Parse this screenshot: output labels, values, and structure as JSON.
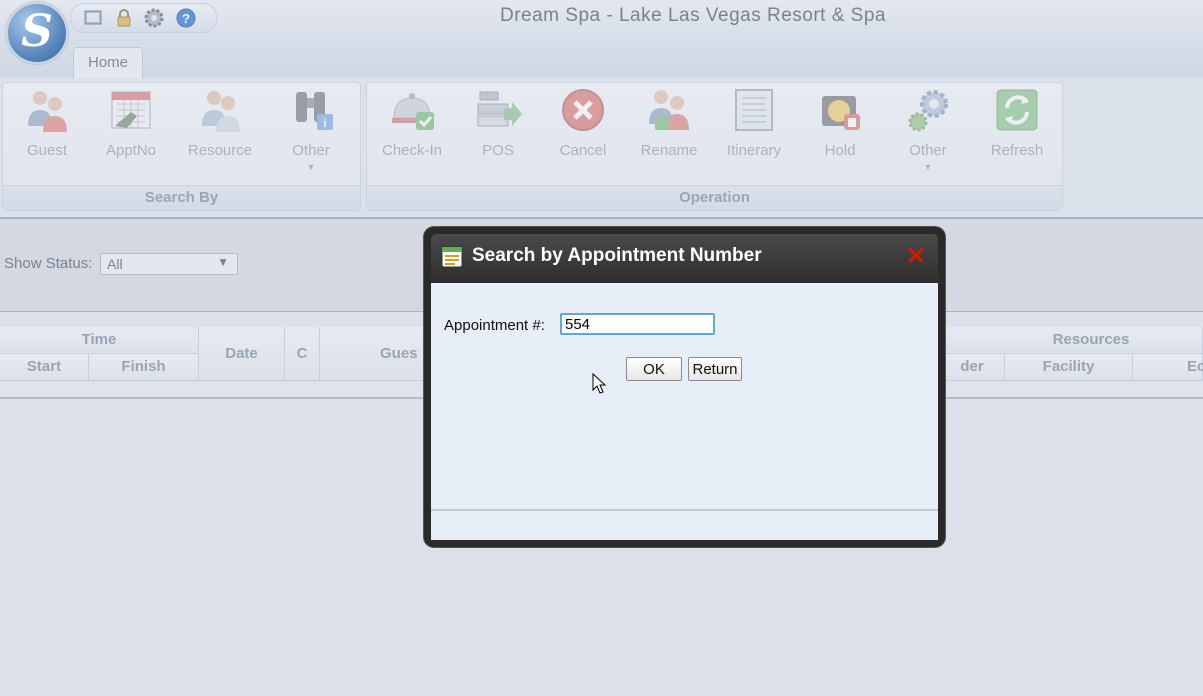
{
  "window": {
    "title": "Dream Spa - Lake Las Vegas Resort & Spa"
  },
  "quick_access": [
    "screen-icon",
    "lock-icon",
    "gear-icon",
    "help-icon"
  ],
  "tabs": [
    {
      "label": "Home",
      "active": true
    }
  ],
  "ribbon": {
    "search_by": {
      "label": "Search By",
      "buttons": [
        {
          "label": "Guest",
          "icon": "guest-icon"
        },
        {
          "label": "ApptNo",
          "icon": "calendar-icon"
        },
        {
          "label": "Resource",
          "icon": "resource-icon"
        },
        {
          "label": "Other",
          "icon": "binoculars-icon",
          "dropdown": "▼"
        }
      ]
    },
    "operation": {
      "label": "Operation",
      "buttons": [
        {
          "label": "Check-In",
          "icon": "bell-icon"
        },
        {
          "label": "POS",
          "icon": "pos-icon"
        },
        {
          "label": "Cancel",
          "icon": "cancel-icon"
        },
        {
          "label": "Rename",
          "icon": "rename-icon"
        },
        {
          "label": "Itinerary",
          "icon": "itinerary-icon"
        },
        {
          "label": "Hold",
          "icon": "hold-icon"
        },
        {
          "label": "Other",
          "icon": "gears-icon",
          "dropdown": "▼"
        },
        {
          "label": "Refresh",
          "icon": "refresh-icon"
        }
      ]
    }
  },
  "filter": {
    "label": "Show Status:",
    "value": "All",
    "arrow": "▼"
  },
  "grid": {
    "group_time": "Time",
    "start": "Start",
    "finish": "Finish",
    "date": "Date",
    "c": "C",
    "guest": "Gues",
    "group_resources": "Resources",
    "provider": "der",
    "facility": "Facility",
    "equipment": "Ec"
  },
  "dialog": {
    "title": "Search by Appointment Number",
    "close": "✕",
    "field_label": "Appointment #:",
    "field_value": "554",
    "ok_label": "OK",
    "return_label": "Return"
  },
  "colors": {
    "close": "#d11b05",
    "focus_border": "#5fa6da",
    "dialog_frame": "#2a2a2a"
  }
}
